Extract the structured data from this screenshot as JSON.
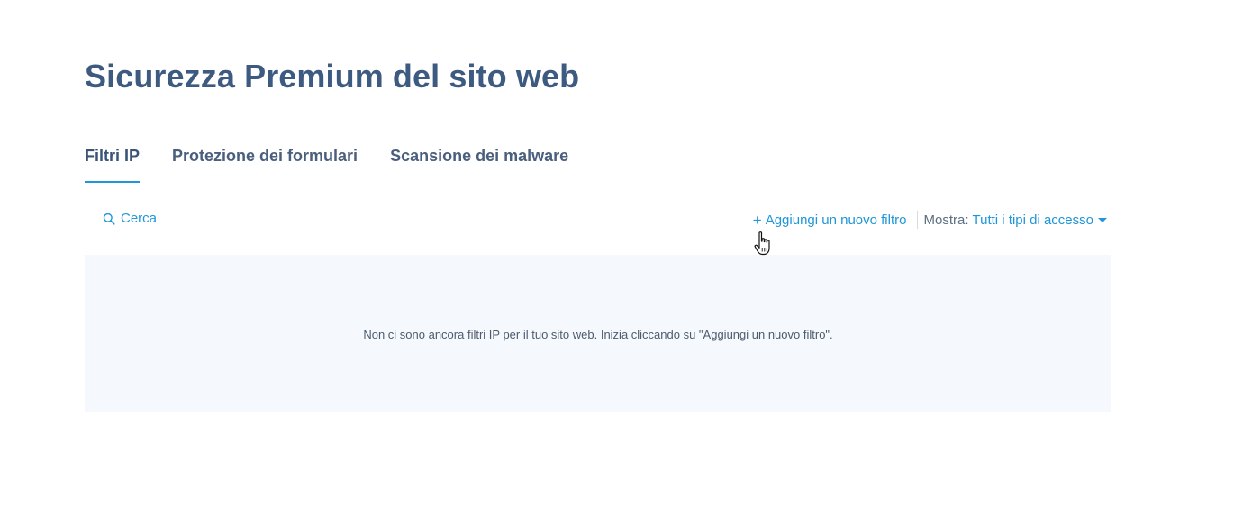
{
  "page": {
    "title": "Sicurezza Premium del sito web"
  },
  "tabs": [
    {
      "label": "Filtri IP",
      "active": true
    },
    {
      "label": "Protezione dei formulari",
      "active": false
    },
    {
      "label": "Scansione dei malware",
      "active": false
    }
  ],
  "toolbar": {
    "search_label": "Cerca",
    "search_icon": "search-icon",
    "add_filter_label": "Aggiungi un nuovo filtro",
    "add_filter_icon": "plus-icon",
    "show_label": "Mostra:",
    "show_value": "Tutti i tipi di accesso"
  },
  "empty_state": {
    "message": "Non ci sono ancora filtri IP per il tuo sito web. Inizia cliccando su \"Aggiungi un nuovo filtro\"."
  },
  "colors": {
    "title": "#3d5a80",
    "accent": "#1f96d8",
    "panel_bg": "#f5f9fd"
  }
}
